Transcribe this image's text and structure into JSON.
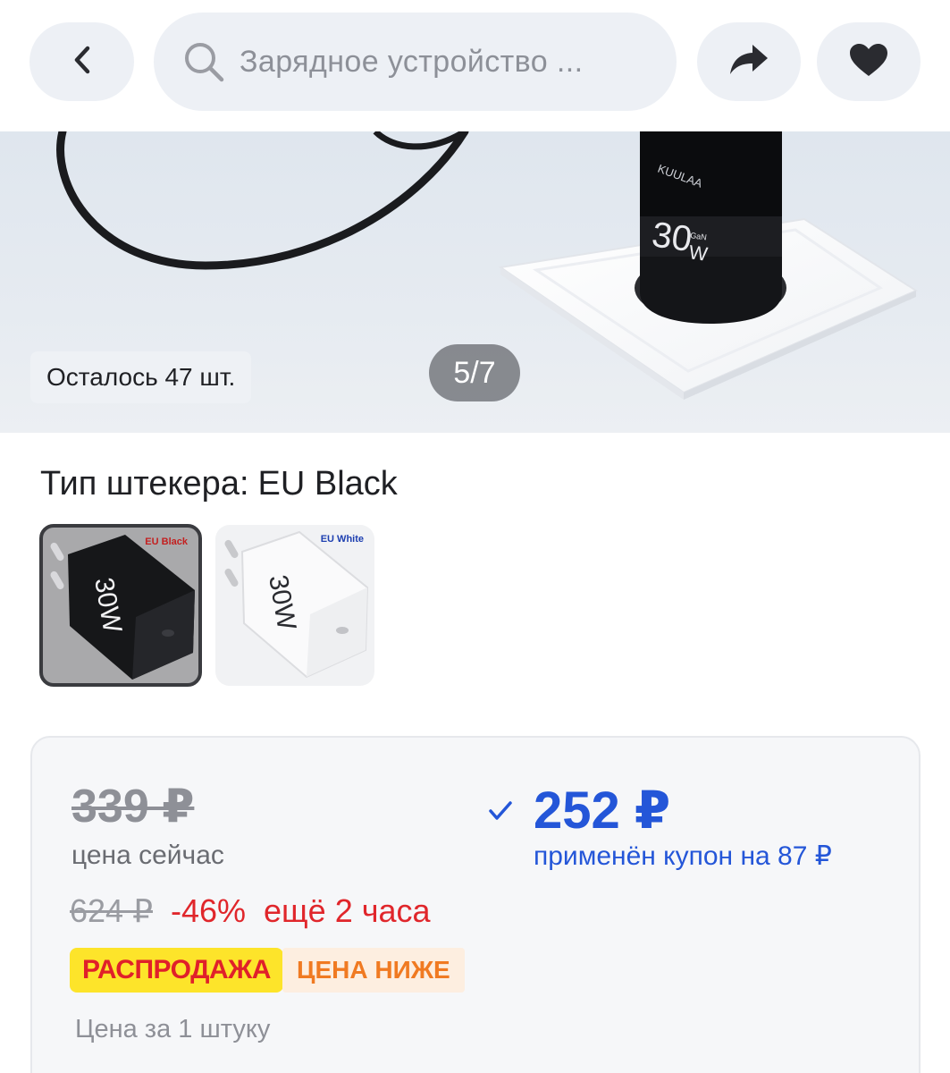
{
  "header": {
    "search_placeholder": "Зарядное устройство ...",
    "back_icon": "chevron-left-icon",
    "share_icon": "share-arrow-icon",
    "favorite_icon": "heart-icon"
  },
  "gallery": {
    "stock_text": "Осталось 47 шт.",
    "page_indicator": "5/7",
    "product_brand": "KUULAA",
    "product_power": "30",
    "product_power_unit": "W",
    "product_gan": "GaN"
  },
  "variant": {
    "label": "Тип штекера:",
    "selected": "EU Black",
    "options": [
      {
        "label": "EU Black",
        "selected": true
      },
      {
        "label": "EU White",
        "selected": false
      }
    ]
  },
  "price": {
    "old_price": "339 ₽",
    "now_label": "цена сейчас",
    "original_price": "624 ₽",
    "discount": "-46%",
    "timer": "ещё 2 часа",
    "coupon_price": "252 ₽",
    "coupon_note": "применён купон на 87 ₽",
    "badge_sale": "РАСПРОДАЖА",
    "badge_lower": "ЦЕНА НИЖЕ",
    "unit_note": "Цена за 1 штуку"
  },
  "colors": {
    "accent_blue": "#2456d8",
    "discount_red": "#e0262b",
    "sale_yellow": "#fde42a",
    "lower_orange": "#f07a22"
  }
}
